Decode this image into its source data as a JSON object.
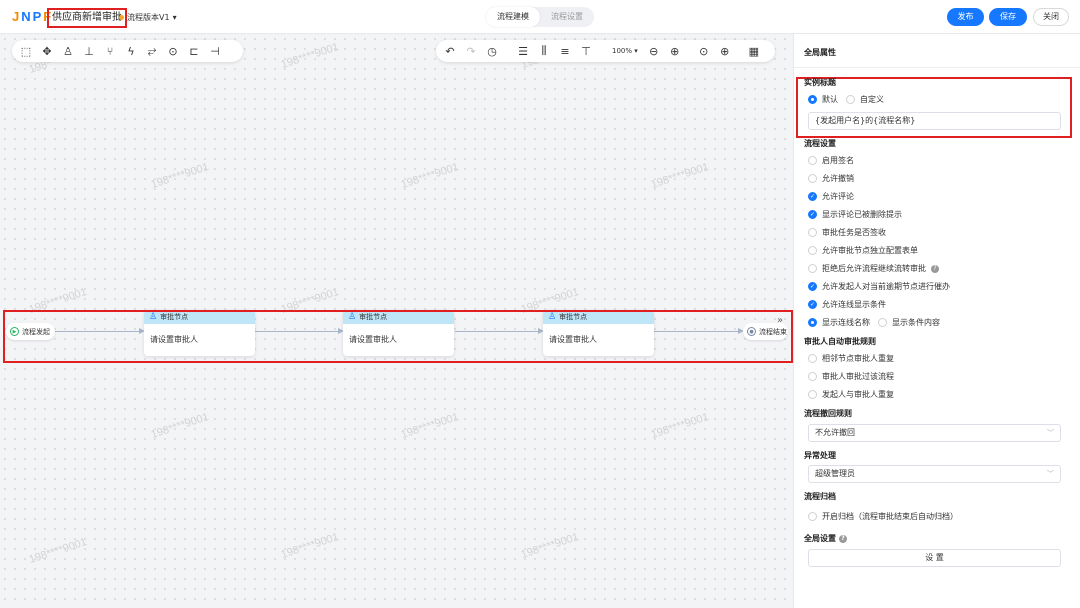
{
  "header": {
    "logo": {
      "j": "J",
      "n": "N",
      "p": "P",
      "f": "F"
    },
    "title": "供应商新增审批",
    "version": "流程版本V1",
    "tabs": [
      "流程建模",
      "流程设置"
    ],
    "publish": "发布",
    "save": "保存",
    "close": "关闭"
  },
  "toolbar": {
    "zoom": "100%",
    "left_icons": [
      "select-icon",
      "move-icon",
      "user-icon",
      "stamp-icon",
      "branch-icon",
      "trigger-icon",
      "subflow-icon",
      "target-icon",
      "tree-icon",
      "structure-icon"
    ],
    "right_icons": [
      "undo-icon",
      "redo-icon",
      "history-icon",
      "align-center-icon",
      "align-middle-icon",
      "align-left-icon",
      "align-top-icon",
      "zoom-out-icon",
      "zoom-in-icon",
      "locate-icon",
      "globe-icon",
      "minimap-icon"
    ]
  },
  "watermark": "198****9001",
  "flow": {
    "start": "流程发起",
    "end": "流程结束",
    "nodes": [
      {
        "title": "审批节点",
        "body": "请设置审批人"
      },
      {
        "title": "审批节点",
        "body": "请设置审批人"
      },
      {
        "title": "审批节点",
        "body": "请设置审批人"
      }
    ]
  },
  "panel": {
    "title": "全局属性",
    "instance_title": {
      "label": "实例标题",
      "options": [
        "默认",
        "自定义"
      ],
      "selected": "默认",
      "value": "{发起用户名}的{流程名称}"
    },
    "process_settings": {
      "label": "流程设置",
      "items": [
        {
          "label": "启用签名",
          "checked": false
        },
        {
          "label": "允许撤销",
          "checked": false
        },
        {
          "label": "允许评论",
          "checked": true
        },
        {
          "label": "显示评论已被删除提示",
          "checked": true
        },
        {
          "label": "审批任务是否签收",
          "checked": false
        },
        {
          "label": "允许审批节点独立配置表单",
          "checked": false
        },
        {
          "label": "拒绝后允许流程继续流转审批",
          "checked": false
        },
        {
          "label": "允许发起人对当前逾期节点进行催办",
          "checked": true
        },
        {
          "label": "允许连线显示条件",
          "checked": true
        }
      ],
      "display_options": [
        "显示连线名称",
        "显示条件内容"
      ],
      "display_selected": "显示连线名称"
    },
    "auto_approve": {
      "label": "审批人自动审批规则",
      "items": [
        "相邻节点审批人重复",
        "审批人审批过该流程",
        "发起人与审批人重复"
      ]
    },
    "withdraw": {
      "label": "流程撤回规则",
      "value": "不允许撤回"
    },
    "exception": {
      "label": "异常处理",
      "value": "超级管理员"
    },
    "archive": {
      "label": "流程归档",
      "item": "开启归档（流程审批结束后自动归档）"
    },
    "global": {
      "label": "全局设置",
      "button": "设 置"
    }
  },
  "colors": {
    "primary": "#1677ff",
    "highlight": "#e02020",
    "node_header": "#bfe6f7"
  }
}
